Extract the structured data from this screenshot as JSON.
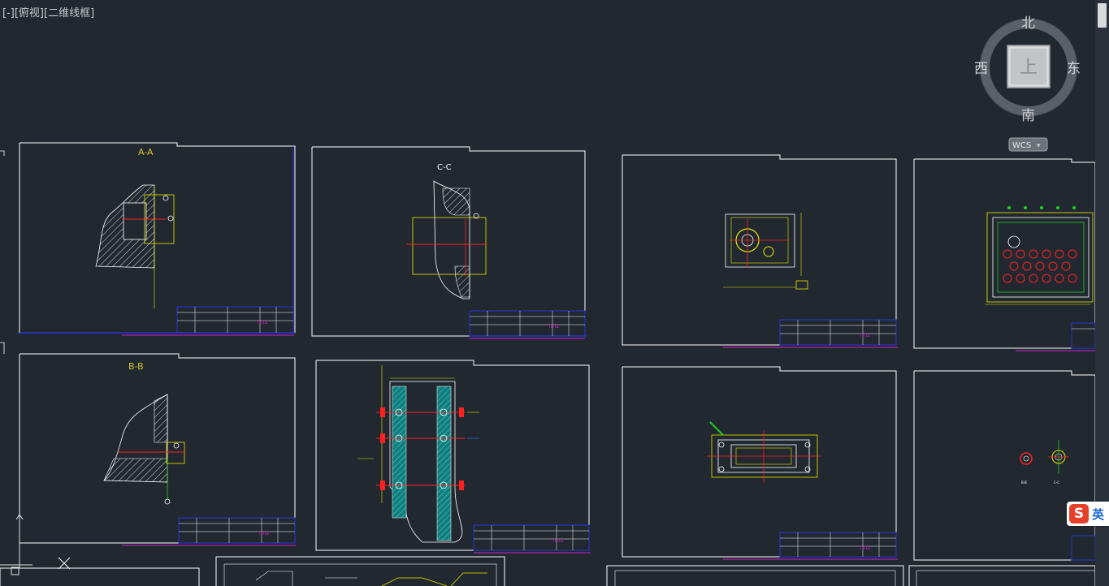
{
  "viewport": {
    "label_parts": [
      "[-]",
      "[俯视]",
      "[二维线框]"
    ]
  },
  "viewcube": {
    "north": "北",
    "south": "南",
    "east": "东",
    "west": "西",
    "face": "上",
    "wcs_label": "WCS",
    "wcs_arrow": "▾"
  },
  "sheets": {
    "s1": {
      "section": "A-A"
    },
    "s2": {
      "section": "C-C"
    },
    "s5": {
      "section": "B-B"
    },
    "s8_labels": [
      "B-B",
      "C-C"
    ]
  },
  "title_block": {
    "title": "TITLE"
  },
  "ime": {
    "logo": "S",
    "lang": "英"
  },
  "colors": {
    "background": "#212830",
    "sheet_border": "#ffffff",
    "section_label": "#d4c32a",
    "dim_yellow": "#e6e600",
    "centerline_red": "#ff2020",
    "frame_blue": "#2b34d8",
    "magenta": "#d020d0",
    "green": "#22cc22",
    "cyan_hatch": "#1aa3a3"
  }
}
